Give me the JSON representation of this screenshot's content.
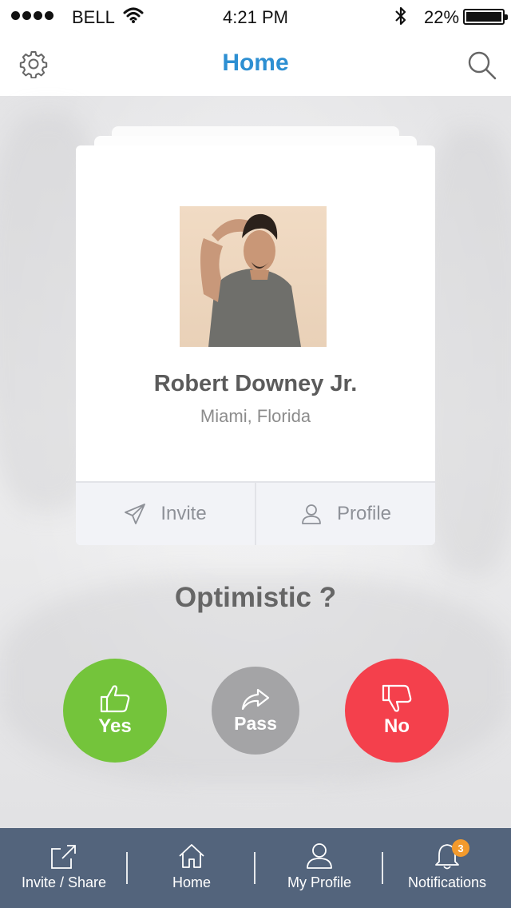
{
  "status_bar": {
    "carrier": "BELL",
    "time": "4:21 PM",
    "battery": "22%"
  },
  "nav": {
    "title": "Home",
    "left_icon": "gear-icon",
    "right_icon": "search-icon"
  },
  "card": {
    "name": "Robert Downey Jr.",
    "location": "Miami, Florida",
    "actions": [
      {
        "label": "Invite",
        "icon": "paper-plane-icon"
      },
      {
        "label": "Profile",
        "icon": "user-icon"
      }
    ]
  },
  "question": "Optimistic ?",
  "answers": {
    "yes": {
      "label": "Yes",
      "icon": "thumbs-up-icon",
      "color": "#74c43b"
    },
    "pass": {
      "label": "Pass",
      "icon": "share-arrow-icon",
      "color": "#a4a4a6"
    },
    "no": {
      "label": "No",
      "icon": "thumbs-down-icon",
      "color": "#f4404c"
    }
  },
  "tab_bar": {
    "color": "#53647c",
    "tabs": [
      {
        "label": "Invite / Share",
        "icon": "share-box-icon"
      },
      {
        "label": "Home",
        "icon": "home-icon"
      },
      {
        "label": "My Profile",
        "icon": "user-icon"
      },
      {
        "label": "Notifications",
        "icon": "bell-icon",
        "badge": "3"
      }
    ]
  },
  "colors": {
    "accent": "#2d8fd2",
    "badge": "#f39a2c"
  }
}
